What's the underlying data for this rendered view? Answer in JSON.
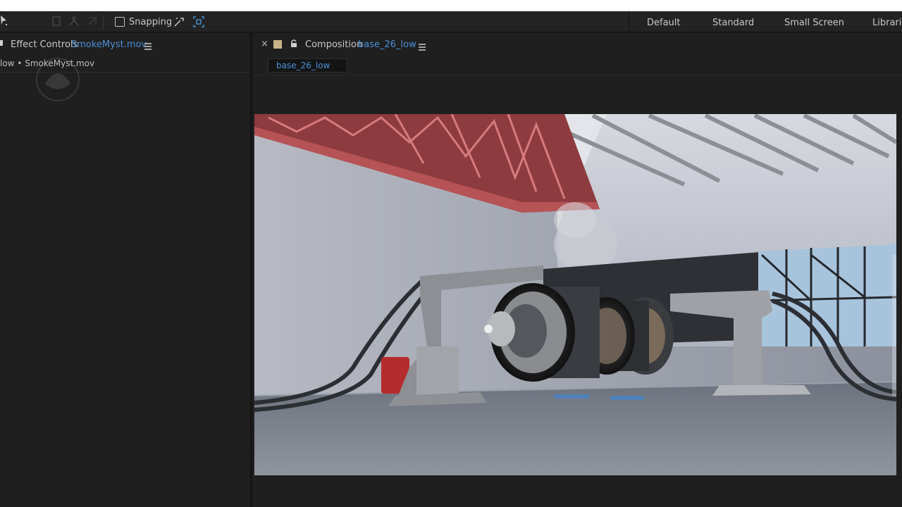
{
  "toolbar": {
    "snapping_label": "Snapping",
    "snapping_checked": false,
    "workspaces": [
      "Default",
      "Standard",
      "Small Screen",
      "Librarie"
    ]
  },
  "effect_controls": {
    "label": "Effect Controls",
    "file": "SmokeMyst.mov",
    "subtitle": "low • SmokeMyst.mov"
  },
  "composition": {
    "close": "×",
    "label": "Composition",
    "name": "base_26_low",
    "tab": "base_26_low"
  },
  "colors": {
    "accent_blue": "#4a90d9",
    "label_swatch": "#c8b48a",
    "panel_bg": "#1f1f1f"
  },
  "icons": {
    "pen": "pen-tool-icon",
    "puppet": "puppet-tool-icon",
    "snap_edges": "snap-edges-icon",
    "snap_features": "snap-features-icon",
    "menu": "hamburger-menu-icon",
    "lock": "lock-icon"
  }
}
